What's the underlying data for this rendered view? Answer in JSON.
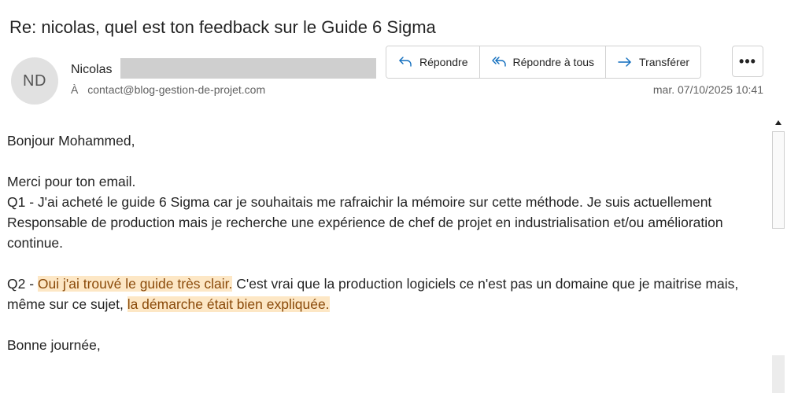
{
  "email": {
    "subject": "Re: nicolas, quel est ton feedback sur le Guide 6 Sigma",
    "avatar_initials": "ND",
    "sender_name": "Nicolas",
    "to_label": "À",
    "to_address": "contact@blog-gestion-de-projet.com",
    "date": "mar. 07/10/2025 10:41"
  },
  "actions": {
    "reply": "Répondre",
    "reply_all": "Répondre à tous",
    "forward": "Transférer",
    "more": "•••"
  },
  "body": {
    "greeting": "Bonjour Mohammed,",
    "thanks": "Merci pour ton email.",
    "q1": "Q1 - J'ai acheté le guide 6 Sigma car je souhaitais me rafraichir la mémoire sur cette méthode. Je suis actuellement Responsable de production mais je recherche une expérience de chef de projet en industrialisation et/ou amélioration continue.",
    "q2_prefix": "Q2 - ",
    "q2_highlight1": "Oui j'ai trouvé le guide très clair.",
    "q2_middle": " C'est vrai que la production logiciels ce n'est pas un domaine que je maitrise mais, même sur ce sujet, ",
    "q2_highlight2": "la démarche était bien expliquée.",
    "closing": "Bonne journée,"
  },
  "colors": {
    "highlight_bg": "#fde7c5",
    "highlight_text": "#8a4a0a",
    "accent": "#0f6cbd"
  }
}
